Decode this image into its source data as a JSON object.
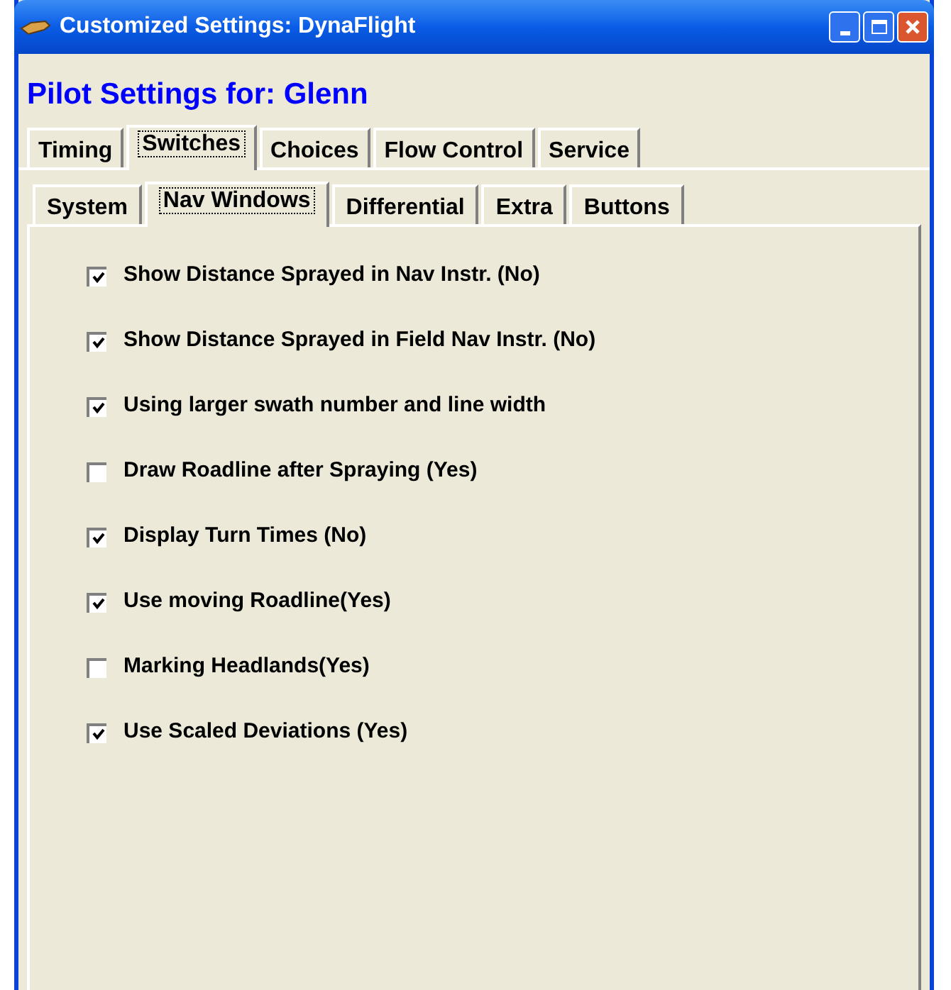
{
  "window": {
    "title": "Customized Settings: DynaFlight"
  },
  "heading": "Pilot Settings for: Glenn",
  "tabs": [
    {
      "label": "Timing",
      "selected": false
    },
    {
      "label": "Switches",
      "selected": true
    },
    {
      "label": "Choices",
      "selected": false
    },
    {
      "label": "Flow Control",
      "selected": false
    },
    {
      "label": "Service",
      "selected": false
    }
  ],
  "subtabs": [
    {
      "label": "System",
      "selected": false
    },
    {
      "label": "Nav Windows",
      "selected": true
    },
    {
      "label": "Differential",
      "selected": false
    },
    {
      "label": "Extra",
      "selected": false
    },
    {
      "label": "Buttons",
      "selected": false
    }
  ],
  "options": [
    {
      "label": "Show Distance Sprayed in Nav Instr. (No)",
      "checked": true
    },
    {
      "label": "Show Distance Sprayed in Field Nav Instr. (No)",
      "checked": true
    },
    {
      "label": "Using larger swath number and line width",
      "checked": true
    },
    {
      "label": "Draw Roadline after Spraying (Yes)",
      "checked": false
    },
    {
      "label": "Display Turn Times (No)",
      "checked": true
    },
    {
      "label": "Use moving Roadline(Yes)",
      "checked": true
    },
    {
      "label": "Marking Headlands(Yes)",
      "checked": false
    },
    {
      "label": "Use Scaled Deviations (Yes)",
      "checked": true
    }
  ]
}
